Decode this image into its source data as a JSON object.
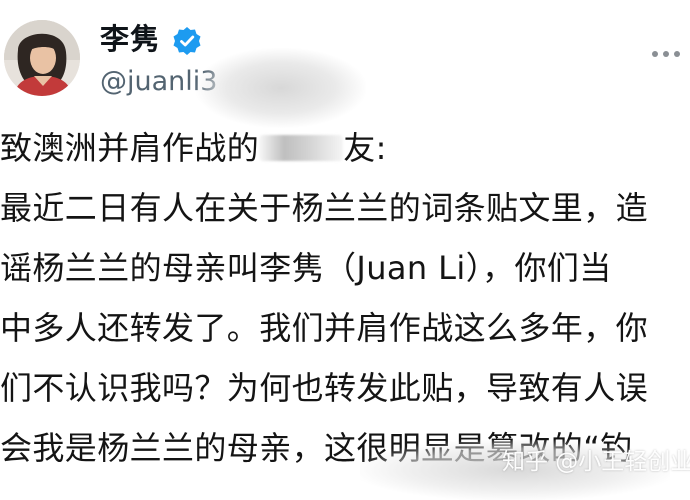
{
  "profile": {
    "display_name": "李隽",
    "handle": "@juanli3",
    "verified_icon": "verified-badge-icon",
    "verified_color": "#1d9bf0"
  },
  "post": {
    "lines": [
      {
        "before": "致澳洲并肩作战的",
        "after": "友:"
      },
      {
        "text": "最近二日有人在关于杨兰兰的词条贴文里，造"
      },
      {
        "text": "谣杨兰兰的母亲叫李隽（Juan Li），你们当"
      },
      {
        "text": "中多人还转发了。我们并肩作战这么多年，你"
      },
      {
        "text": "们不认识我吗？为何也转发此贴，导致有人误"
      },
      {
        "text": "会我是杨兰兰的母亲，这很明显是篡改的“钓"
      }
    ]
  },
  "watermark": {
    "text": "知乎 @小王轻创业"
  },
  "colors": {
    "text": "#141414",
    "handle": "#536471"
  }
}
